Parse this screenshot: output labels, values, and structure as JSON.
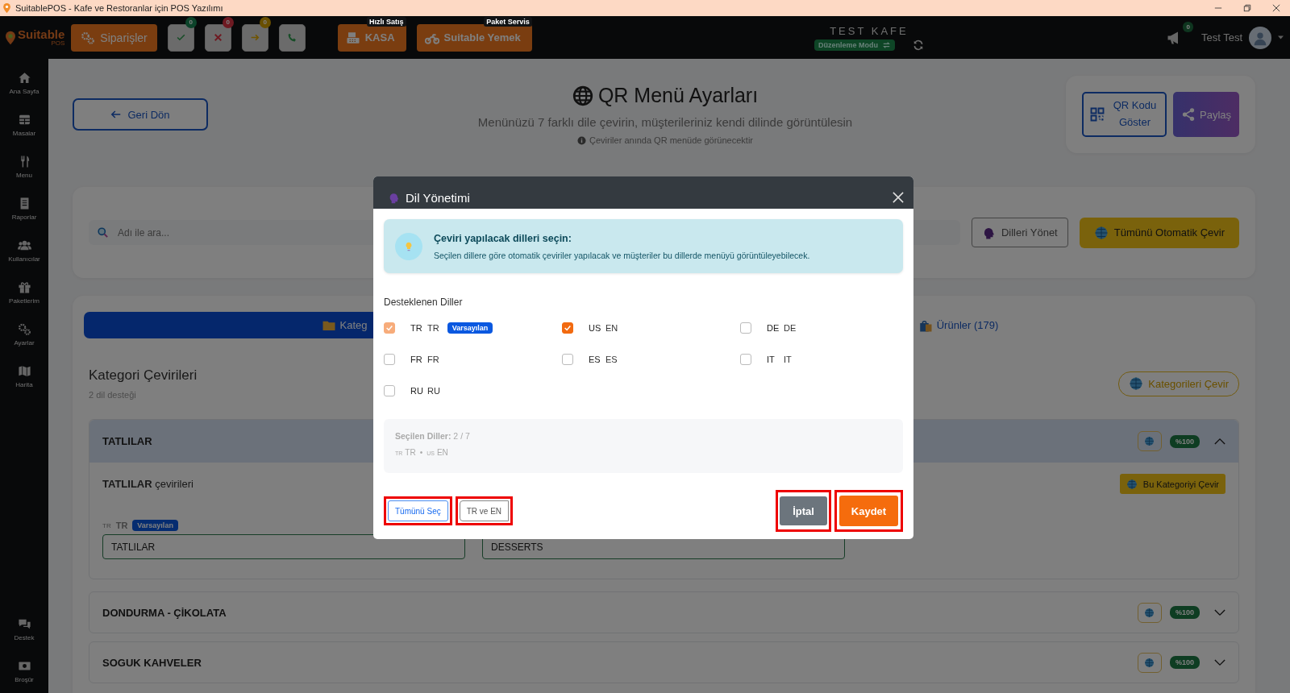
{
  "window": {
    "title": "SuitablePOS - Kafe ve Restoranlar için POS Yazılımı"
  },
  "topbar": {
    "logo": {
      "name": "Suitable",
      "sub": "POS"
    },
    "orders_button": "Siparişler",
    "status_buttons": [
      {
        "kind": "check",
        "badge": "0"
      },
      {
        "kind": "cross",
        "badge": "0"
      },
      {
        "kind": "arrow",
        "badge": "0"
      },
      {
        "kind": "phone"
      }
    ],
    "action_buttons": [
      {
        "kind": "register",
        "caption": "Hızlı Satış",
        "label": "KASA"
      },
      {
        "kind": "delivery",
        "caption": "Paket Servis",
        "label": "Suitable Yemek"
      }
    ],
    "venue": "TEST KAFE",
    "mode": "Düzenleme Modu",
    "notifications": "0",
    "user": "Test Test"
  },
  "sidebar": {
    "items": [
      {
        "kind": "home",
        "label": "Ana Sayfa"
      },
      {
        "kind": "tables",
        "label": "Masalar"
      },
      {
        "kind": "menu",
        "label": "Menu"
      },
      {
        "kind": "reports",
        "label": "Raporlar"
      },
      {
        "kind": "users",
        "label": "Kullanıcılar"
      },
      {
        "kind": "packages",
        "label": "Paketlerim"
      },
      {
        "kind": "settings",
        "label": "Ayarlar"
      },
      {
        "kind": "map",
        "label": "Harita"
      }
    ],
    "bottom_items": [
      {
        "kind": "support",
        "label": "Destek"
      },
      {
        "kind": "brochure",
        "label": "Broşür"
      }
    ]
  },
  "page": {
    "back_button": "Geri Dön",
    "title": "QR Menü Ayarları",
    "subtitle": "Menünüzü 7 farklı dile çevirin, müşterileriniz kendi dilinde görüntülesin",
    "note": "Çeviriler anında QR menüde görünecektir",
    "qr_button": "QR Kodu Göster",
    "share_button": "Paylaş",
    "search": {
      "placeholder": "Adı ile ara..."
    },
    "manage_button": "Dilleri Yönet",
    "translate_all_button": "Tümünü Otomatik Çevir",
    "tabs": [
      {
        "label": "Kateg",
        "selected": true
      },
      {
        "label": "Ürünler (179)",
        "selected": false
      }
    ],
    "section_title": "Kategori Çevirileri",
    "section_sub": "2 dil desteği",
    "translate_categories_button": "Kategorileri Çevir",
    "categories": [
      {
        "name": "TATLILAR",
        "progress": "%100",
        "expanded": true,
        "body_title": "**TATLILAR** çevirileri",
        "translate_button": "Bu Kategoriyi Çevir",
        "field_code": "TR",
        "field_lang": "TR",
        "field_badge": "Varsayılan",
        "values": [
          "TATLILAR",
          "DESSERTS"
        ]
      },
      {
        "name": "DONDURMA - ÇİKOLATA",
        "progress": "%100",
        "expanded": false
      },
      {
        "name": "SOGUK KAHVELER",
        "progress": "%100",
        "expanded": false
      }
    ]
  },
  "dialog": {
    "title": "Dil Yönetimi",
    "info_title": "Çeviri yapılacak dilleri seçin:",
    "info_text": "Seçilen dillere göre otomatik çeviriler yapılacak ve müşteriler bu dillerde menüyü görüntüleyebilecek.",
    "section": "Desteklenen Diller",
    "languages": [
      {
        "code": "TR",
        "name": "TR",
        "checked": true,
        "disabled": true,
        "badge": "Varsayılan"
      },
      {
        "code": "US",
        "name": "EN",
        "checked": true,
        "disabled": false
      },
      {
        "code": "DE",
        "name": "DE",
        "checked": false,
        "disabled": false
      },
      {
        "code": "FR",
        "name": "FR",
        "checked": false,
        "disabled": false
      },
      {
        "code": "ES",
        "name": "ES",
        "checked": false,
        "disabled": false
      },
      {
        "code": "IT",
        "name": "IT",
        "checked": false,
        "disabled": false
      },
      {
        "code": "RU",
        "name": "RU",
        "checked": false,
        "disabled": false
      }
    ],
    "summary_label": "**Seçilen Diller:** 2 / 7",
    "summary": [
      {
        "code": "TR",
        "name": "TR"
      },
      {
        "code": "US",
        "name": "EN"
      }
    ],
    "separator": "•",
    "buttons": [
      {
        "kind": "select-all",
        "label": "Tümünü Seç",
        "highlighted": true
      },
      {
        "kind": "preset",
        "label": "TR ve EN",
        "highlighted": true
      },
      {
        "kind": "cancel",
        "label": "İptal",
        "highlighted": true
      },
      {
        "kind": "save",
        "label": "Kaydet",
        "highlighted": true
      }
    ]
  }
}
